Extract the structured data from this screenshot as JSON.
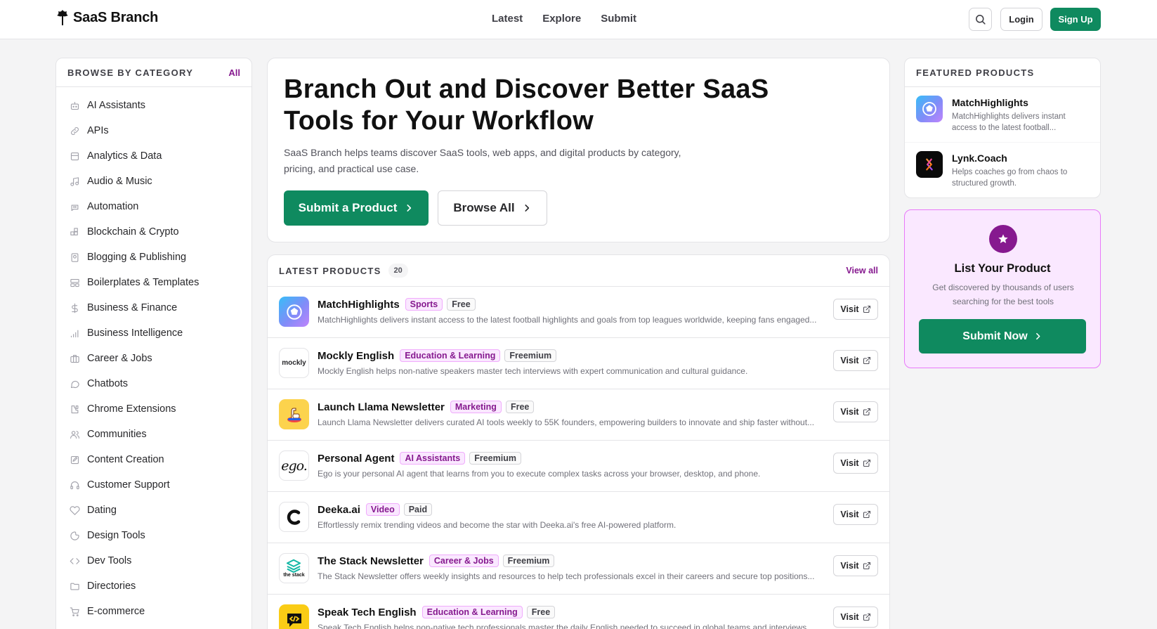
{
  "header": {
    "brand": "SaaS Branch",
    "nav": [
      "Latest",
      "Explore",
      "Submit"
    ],
    "login": "Login",
    "signup": "Sign Up"
  },
  "sidebar": {
    "title": "BROWSE BY CATEGORY",
    "all_link": "All",
    "categories": [
      {
        "label": "AI Assistants",
        "icon": "bot-icon"
      },
      {
        "label": "APIs",
        "icon": "link-icon"
      },
      {
        "label": "Analytics & Data",
        "icon": "database-icon"
      },
      {
        "label": "Audio & Music",
        "icon": "music-icon"
      },
      {
        "label": "Automation",
        "icon": "robot-icon"
      },
      {
        "label": "Blockchain & Crypto",
        "icon": "blocks-icon"
      },
      {
        "label": "Blogging & Publishing",
        "icon": "book-icon"
      },
      {
        "label": "Boilerplates & Templates",
        "icon": "template-icon"
      },
      {
        "label": "Business & Finance",
        "icon": "dollar-icon"
      },
      {
        "label": "Business Intelligence",
        "icon": "signal-icon"
      },
      {
        "label": "Career & Jobs",
        "icon": "briefcase-icon"
      },
      {
        "label": "Chatbots",
        "icon": "chat-icon"
      },
      {
        "label": "Chrome Extensions",
        "icon": "puzzle-icon"
      },
      {
        "label": "Communities",
        "icon": "users-icon"
      },
      {
        "label": "Content Creation",
        "icon": "edit-icon"
      },
      {
        "label": "Customer Support",
        "icon": "headset-icon"
      },
      {
        "label": "Dating",
        "icon": "heart-icon"
      },
      {
        "label": "Design Tools",
        "icon": "palette-icon"
      },
      {
        "label": "Dev Tools",
        "icon": "code-icon"
      },
      {
        "label": "Directories",
        "icon": "folder-icon"
      },
      {
        "label": "E-commerce",
        "icon": "cart-icon"
      }
    ]
  },
  "hero": {
    "title": "Branch Out and Discover Better SaaS Tools for Your Workflow",
    "subtitle": "SaaS Branch helps teams discover SaaS tools, web apps, and digital products by category, pricing, and practical use case.",
    "primary_cta": "Submit a Product",
    "secondary_cta": "Browse All"
  },
  "latest": {
    "title": "LATEST PRODUCTS",
    "count": "20",
    "view_all": "View all",
    "visit_label": "Visit",
    "products": [
      {
        "name": "MatchHighlights",
        "category": "Sports",
        "pricing": "Free",
        "logo": "soccer-ball-icon",
        "desc": "MatchHighlights delivers instant access to the latest football highlights and goals from top leagues worldwide, keeping fans engaged..."
      },
      {
        "name": "Mockly English",
        "category": "Education & Learning",
        "pricing": "Freemium",
        "logo": "mockly-logo",
        "logo_text": "mockly",
        "desc": "Mockly English helps non-native speakers master tech interviews with expert communication and cultural guidance."
      },
      {
        "name": "Launch Llama Newsletter",
        "category": "Marketing",
        "pricing": "Free",
        "logo": "llama-icon",
        "desc": "Launch Llama Newsletter delivers curated AI tools weekly to 55K founders, empowering builders to innovate and ship faster without..."
      },
      {
        "name": "Personal Agent",
        "category": "AI Assistants",
        "pricing": "Freemium",
        "logo": "ego-logo",
        "logo_text": "ego.",
        "desc": "Ego is your personal AI agent that learns from you to execute complex tasks across your browser, desktop, and phone."
      },
      {
        "name": "Deeka.ai",
        "category": "Video",
        "pricing": "Paid",
        "logo": "deeka-logo",
        "desc": "Effortlessly remix trending videos and become the star with Deeka.ai's free AI-powered platform."
      },
      {
        "name": "The Stack Newsletter",
        "category": "Career & Jobs",
        "pricing": "Freemium",
        "logo": "stack-logo",
        "logo_text": "the stack",
        "desc": "The Stack Newsletter offers weekly insights and resources to help tech professionals excel in their careers and secure top positions..."
      },
      {
        "name": "Speak Tech English",
        "category": "Education & Learning",
        "pricing": "Free",
        "logo": "code-chat-icon",
        "desc": "Speak Tech English helps non-native tech professionals master the daily English needed to succeed in global teams and interviews."
      }
    ]
  },
  "featured": {
    "title": "FEATURED PRODUCTS",
    "items": [
      {
        "name": "MatchHighlights",
        "desc": "MatchHighlights delivers instant access to the latest football...",
        "logo": "soccer-ball-icon"
      },
      {
        "name": "Lynk.Coach",
        "desc": "Helps coaches go from chaos to structured growth.",
        "logo": "lynk-logo"
      }
    ]
  },
  "list_product": {
    "title": "List Your Product",
    "desc": "Get discovered by thousands of users searching for the best tools",
    "cta": "Submit Now"
  },
  "colors": {
    "brand_green": "#0f8a5f",
    "accent_purple": "#86198f",
    "accent_pink_bg": "#fae8ff"
  }
}
